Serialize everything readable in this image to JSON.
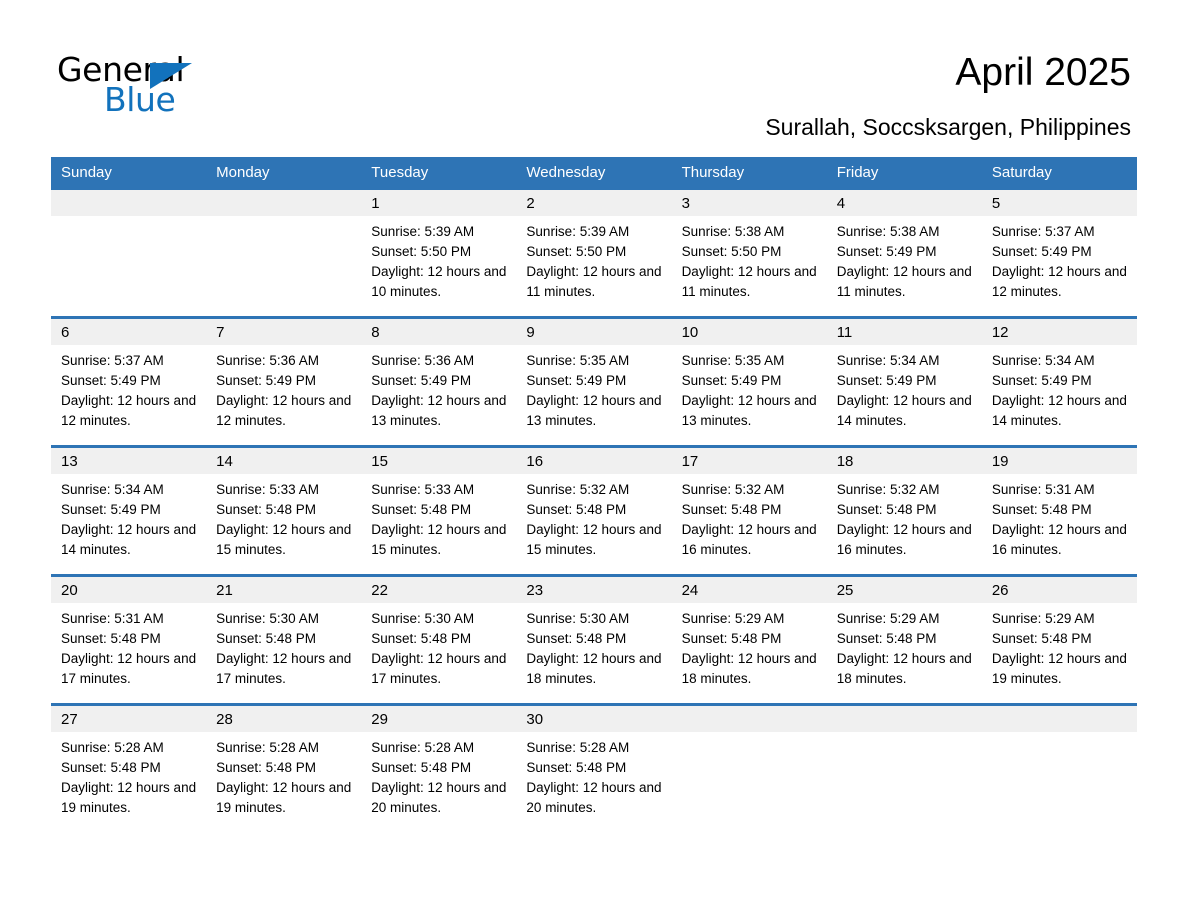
{
  "brand": {
    "name_part1": "General",
    "name_part2": "Blue",
    "accent_color": "#1272bc"
  },
  "header": {
    "month_title": "April 2025",
    "location": "Surallah, Soccsksargen, Philippines"
  },
  "calendar": {
    "header_color": "#2e74b5",
    "daynum_band_color": "#f0f0f0",
    "weekday_headers": [
      "Sunday",
      "Monday",
      "Tuesday",
      "Wednesday",
      "Thursday",
      "Friday",
      "Saturday"
    ],
    "weeks": [
      [
        {
          "day": "",
          "sunrise": "",
          "sunset": "",
          "daylight": ""
        },
        {
          "day": "",
          "sunrise": "",
          "sunset": "",
          "daylight": ""
        },
        {
          "day": "1",
          "sunrise": "Sunrise: 5:39 AM",
          "sunset": "Sunset: 5:50 PM",
          "daylight": "Daylight: 12 hours and 10 minutes."
        },
        {
          "day": "2",
          "sunrise": "Sunrise: 5:39 AM",
          "sunset": "Sunset: 5:50 PM",
          "daylight": "Daylight: 12 hours and 11 minutes."
        },
        {
          "day": "3",
          "sunrise": "Sunrise: 5:38 AM",
          "sunset": "Sunset: 5:50 PM",
          "daylight": "Daylight: 12 hours and 11 minutes."
        },
        {
          "day": "4",
          "sunrise": "Sunrise: 5:38 AM",
          "sunset": "Sunset: 5:49 PM",
          "daylight": "Daylight: 12 hours and 11 minutes."
        },
        {
          "day": "5",
          "sunrise": "Sunrise: 5:37 AM",
          "sunset": "Sunset: 5:49 PM",
          "daylight": "Daylight: 12 hours and 12 minutes."
        }
      ],
      [
        {
          "day": "6",
          "sunrise": "Sunrise: 5:37 AM",
          "sunset": "Sunset: 5:49 PM",
          "daylight": "Daylight: 12 hours and 12 minutes."
        },
        {
          "day": "7",
          "sunrise": "Sunrise: 5:36 AM",
          "sunset": "Sunset: 5:49 PM",
          "daylight": "Daylight: 12 hours and 12 minutes."
        },
        {
          "day": "8",
          "sunrise": "Sunrise: 5:36 AM",
          "sunset": "Sunset: 5:49 PM",
          "daylight": "Daylight: 12 hours and 13 minutes."
        },
        {
          "day": "9",
          "sunrise": "Sunrise: 5:35 AM",
          "sunset": "Sunset: 5:49 PM",
          "daylight": "Daylight: 12 hours and 13 minutes."
        },
        {
          "day": "10",
          "sunrise": "Sunrise: 5:35 AM",
          "sunset": "Sunset: 5:49 PM",
          "daylight": "Daylight: 12 hours and 13 minutes."
        },
        {
          "day": "11",
          "sunrise": "Sunrise: 5:34 AM",
          "sunset": "Sunset: 5:49 PM",
          "daylight": "Daylight: 12 hours and 14 minutes."
        },
        {
          "day": "12",
          "sunrise": "Sunrise: 5:34 AM",
          "sunset": "Sunset: 5:49 PM",
          "daylight": "Daylight: 12 hours and 14 minutes."
        }
      ],
      [
        {
          "day": "13",
          "sunrise": "Sunrise: 5:34 AM",
          "sunset": "Sunset: 5:49 PM",
          "daylight": "Daylight: 12 hours and 14 minutes."
        },
        {
          "day": "14",
          "sunrise": "Sunrise: 5:33 AM",
          "sunset": "Sunset: 5:48 PM",
          "daylight": "Daylight: 12 hours and 15 minutes."
        },
        {
          "day": "15",
          "sunrise": "Sunrise: 5:33 AM",
          "sunset": "Sunset: 5:48 PM",
          "daylight": "Daylight: 12 hours and 15 minutes."
        },
        {
          "day": "16",
          "sunrise": "Sunrise: 5:32 AM",
          "sunset": "Sunset: 5:48 PM",
          "daylight": "Daylight: 12 hours and 15 minutes."
        },
        {
          "day": "17",
          "sunrise": "Sunrise: 5:32 AM",
          "sunset": "Sunset: 5:48 PM",
          "daylight": "Daylight: 12 hours and 16 minutes."
        },
        {
          "day": "18",
          "sunrise": "Sunrise: 5:32 AM",
          "sunset": "Sunset: 5:48 PM",
          "daylight": "Daylight: 12 hours and 16 minutes."
        },
        {
          "day": "19",
          "sunrise": "Sunrise: 5:31 AM",
          "sunset": "Sunset: 5:48 PM",
          "daylight": "Daylight: 12 hours and 16 minutes."
        }
      ],
      [
        {
          "day": "20",
          "sunrise": "Sunrise: 5:31 AM",
          "sunset": "Sunset: 5:48 PM",
          "daylight": "Daylight: 12 hours and 17 minutes."
        },
        {
          "day": "21",
          "sunrise": "Sunrise: 5:30 AM",
          "sunset": "Sunset: 5:48 PM",
          "daylight": "Daylight: 12 hours and 17 minutes."
        },
        {
          "day": "22",
          "sunrise": "Sunrise: 5:30 AM",
          "sunset": "Sunset: 5:48 PM",
          "daylight": "Daylight: 12 hours and 17 minutes."
        },
        {
          "day": "23",
          "sunrise": "Sunrise: 5:30 AM",
          "sunset": "Sunset: 5:48 PM",
          "daylight": "Daylight: 12 hours and 18 minutes."
        },
        {
          "day": "24",
          "sunrise": "Sunrise: 5:29 AM",
          "sunset": "Sunset: 5:48 PM",
          "daylight": "Daylight: 12 hours and 18 minutes."
        },
        {
          "day": "25",
          "sunrise": "Sunrise: 5:29 AM",
          "sunset": "Sunset: 5:48 PM",
          "daylight": "Daylight: 12 hours and 18 minutes."
        },
        {
          "day": "26",
          "sunrise": "Sunrise: 5:29 AM",
          "sunset": "Sunset: 5:48 PM",
          "daylight": "Daylight: 12 hours and 19 minutes."
        }
      ],
      [
        {
          "day": "27",
          "sunrise": "Sunrise: 5:28 AM",
          "sunset": "Sunset: 5:48 PM",
          "daylight": "Daylight: 12 hours and 19 minutes."
        },
        {
          "day": "28",
          "sunrise": "Sunrise: 5:28 AM",
          "sunset": "Sunset: 5:48 PM",
          "daylight": "Daylight: 12 hours and 19 minutes."
        },
        {
          "day": "29",
          "sunrise": "Sunrise: 5:28 AM",
          "sunset": "Sunset: 5:48 PM",
          "daylight": "Daylight: 12 hours and 20 minutes."
        },
        {
          "day": "30",
          "sunrise": "Sunrise: 5:28 AM",
          "sunset": "Sunset: 5:48 PM",
          "daylight": "Daylight: 12 hours and 20 minutes."
        },
        {
          "day": "",
          "sunrise": "",
          "sunset": "",
          "daylight": ""
        },
        {
          "day": "",
          "sunrise": "",
          "sunset": "",
          "daylight": ""
        },
        {
          "day": "",
          "sunrise": "",
          "sunset": "",
          "daylight": ""
        }
      ]
    ]
  }
}
